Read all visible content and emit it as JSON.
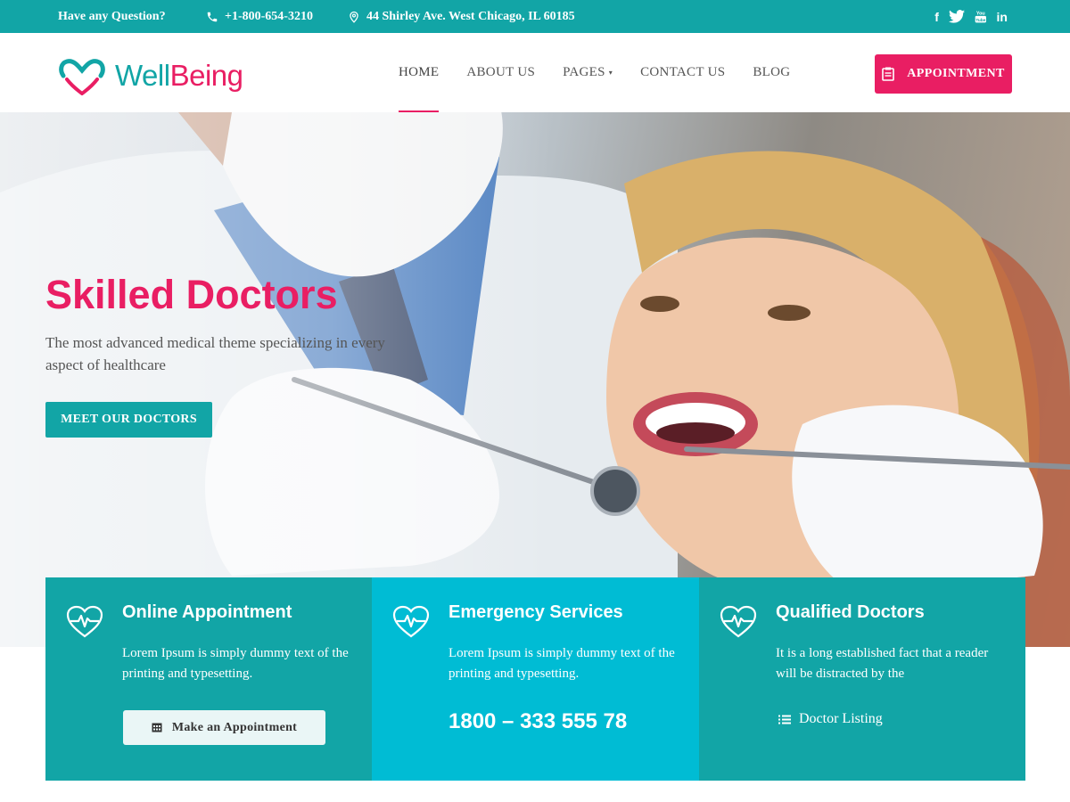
{
  "topbar": {
    "question": "Have any Question?",
    "phone": "+1-800-654-3210",
    "address": "44 Shirley Ave. West Chicago, IL 60185",
    "phone_icon": "phone-icon",
    "address_icon": "map-pin-icon",
    "socials": [
      {
        "icon": "facebook-icon",
        "glyph": "f"
      },
      {
        "icon": "twitter-icon"
      },
      {
        "icon": "youtube-icon"
      },
      {
        "icon": "linkedin-icon",
        "glyph": "in"
      }
    ]
  },
  "header": {
    "logo_well": "Well",
    "logo_being": "Being",
    "nav": [
      {
        "label": "HOME",
        "active": true
      },
      {
        "label": "ABOUT US"
      },
      {
        "label": "PAGES",
        "caret": "▾"
      },
      {
        "label": "CONTACT US"
      },
      {
        "label": "BLOG"
      }
    ],
    "appointment_label": "APPOINTMENT",
    "appointment_icon": "clipboard-icon"
  },
  "hero": {
    "title": "Skilled Doctors",
    "subtitle": "The most advanced medical theme specializing in every aspect of healthcare",
    "button_label": "MEET OUR DOCTORS"
  },
  "features": [
    {
      "icon": "heartbeat-icon",
      "title": "Online Appointment",
      "text": "Lorem Ipsum is simply dummy text of the printing and typesetting.",
      "button_label": "Make an Appointment",
      "button_icon": "calendar-icon"
    },
    {
      "icon": "heartbeat-icon",
      "title": "Emergency Services",
      "text": "Lorem Ipsum is simply dummy text of the printing and typesetting.",
      "phone": "1800 – 333 555 78"
    },
    {
      "icon": "heartbeat-icon",
      "title": "Qualified Doctors",
      "text": "It is a long established fact that a reader will be distracted by the",
      "link_label": "Doctor Listing",
      "link_icon": "list-icon"
    }
  ],
  "colors": {
    "teal": "#12a5a6",
    "cyan": "#00bcd4",
    "pink": "#e91e63"
  }
}
